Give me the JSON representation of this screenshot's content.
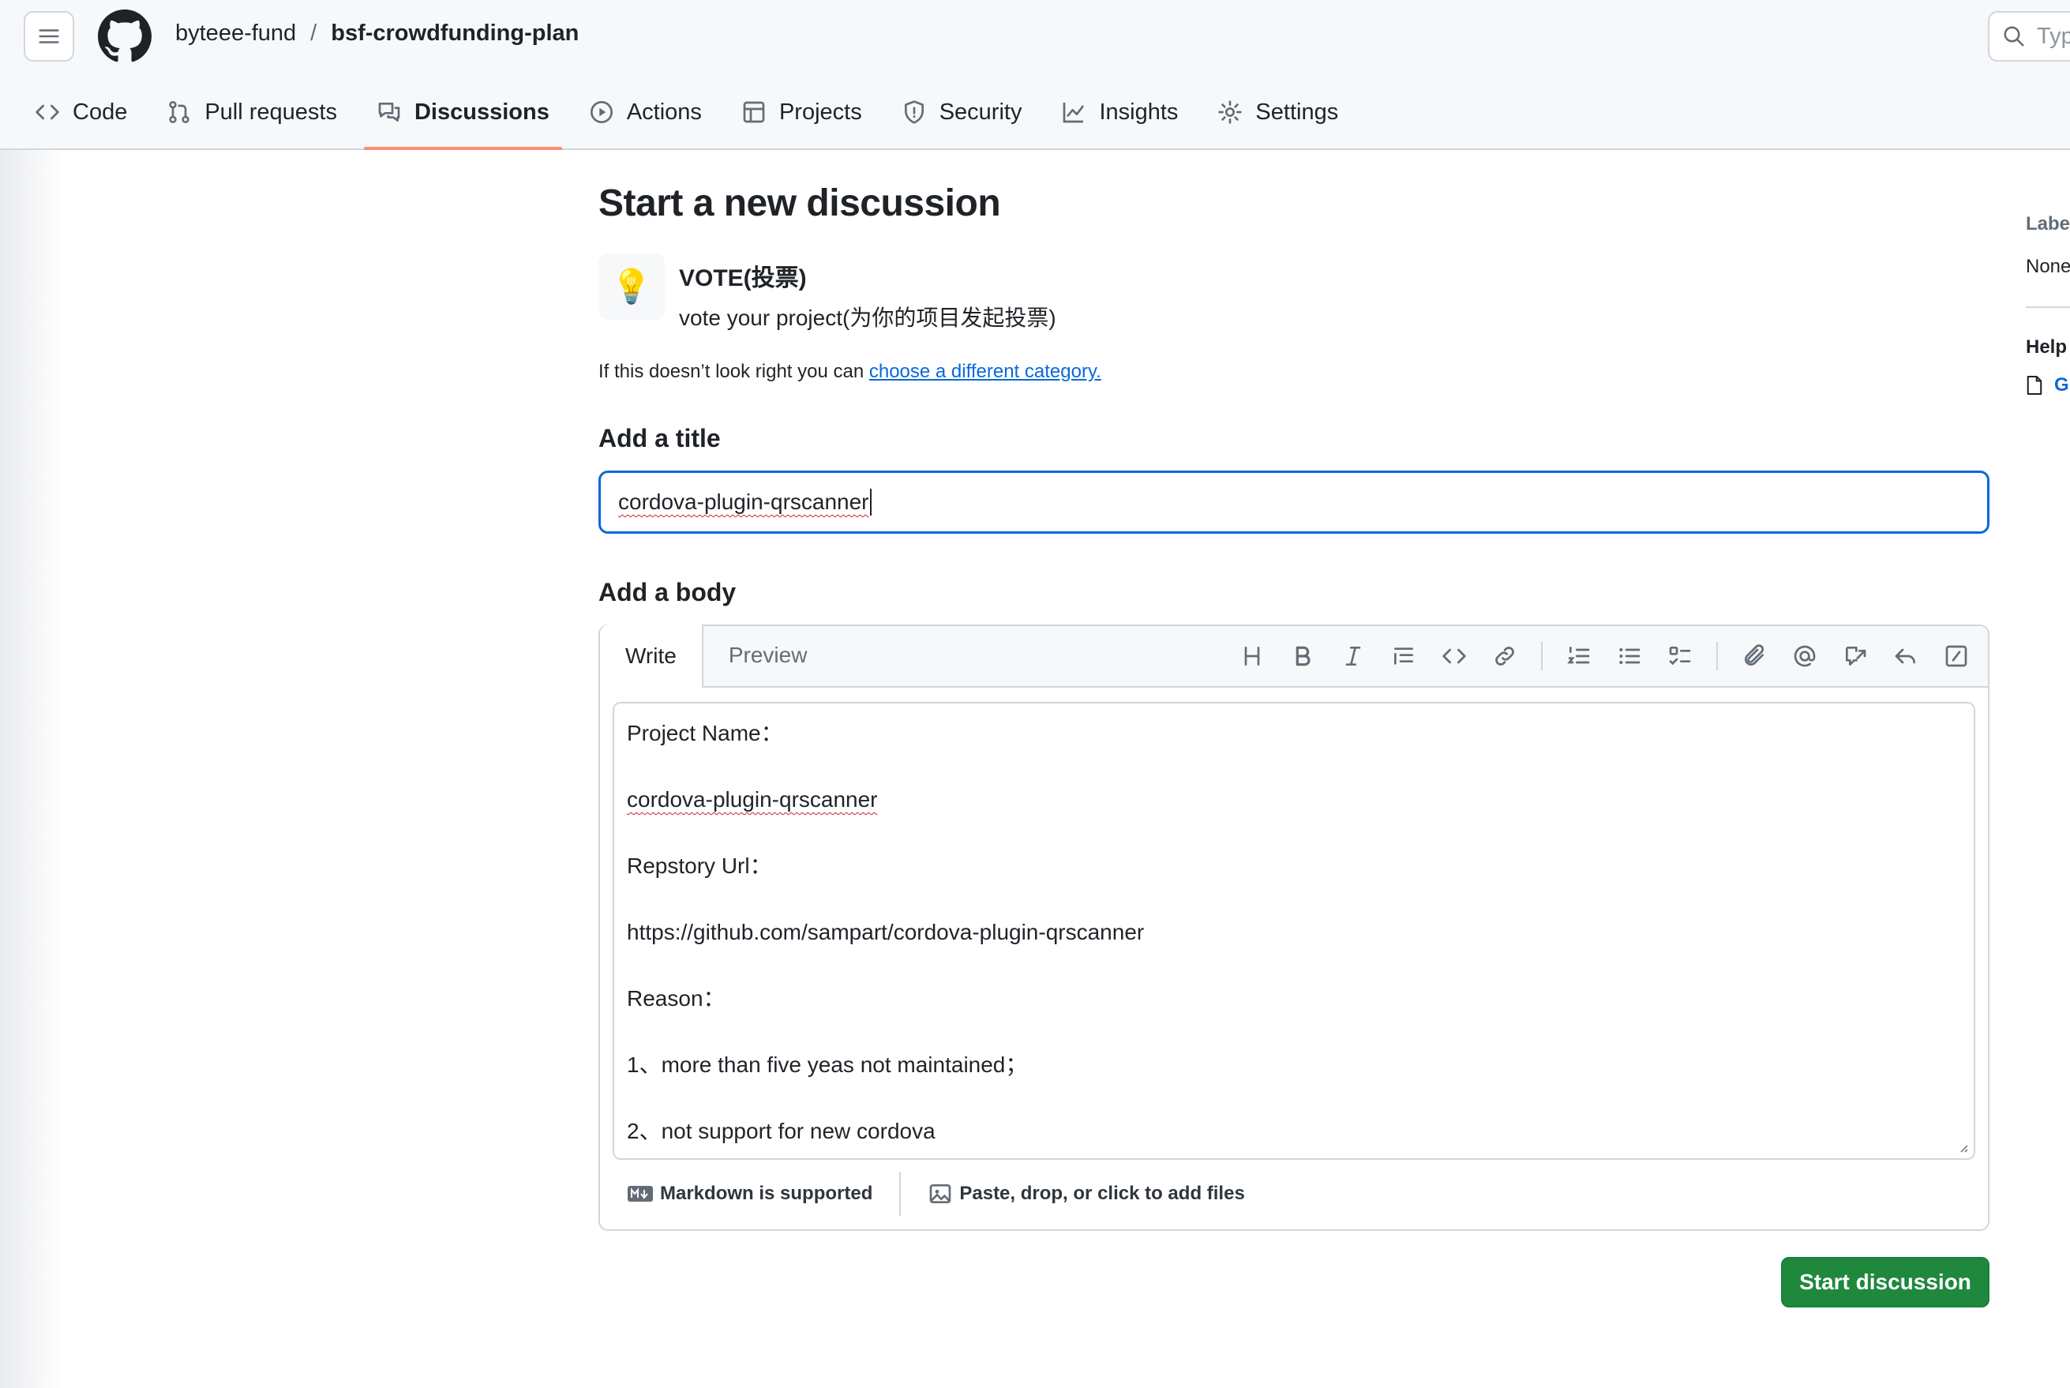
{
  "header": {
    "owner": "byteee-fund",
    "separator": "/",
    "repo": "bsf-crowdfunding-plan",
    "search_placeholder": "Typ"
  },
  "nav_tabs": [
    {
      "label": "Code",
      "icon": "code-icon"
    },
    {
      "label": "Pull requests",
      "icon": "pull-request-icon"
    },
    {
      "label": "Discussions",
      "icon": "discussion-icon",
      "active": true
    },
    {
      "label": "Actions",
      "icon": "play-icon"
    },
    {
      "label": "Projects",
      "icon": "table-icon"
    },
    {
      "label": "Security",
      "icon": "shield-icon"
    },
    {
      "label": "Insights",
      "icon": "graph-icon"
    },
    {
      "label": "Settings",
      "icon": "gear-icon"
    }
  ],
  "main": {
    "page_title": "Start a new discussion",
    "category": {
      "icon": "💡",
      "name": "VOTE(投票)",
      "description": "vote your project(为你的项目发起投票)"
    },
    "hint_text": "If this doesn’t look right you can ",
    "hint_link": "choose a different category.",
    "title_label": "Add a title",
    "title_value": "cordova-plugin-qrscanner",
    "body_label": "Add a body",
    "editor_tabs": {
      "write": "Write",
      "preview": "Preview"
    },
    "body_lines": [
      "Project Name：",
      "cordova-plugin-qrscanner",
      "Repstory Url：",
      "https://github.com/sampart/cordova-plugin-qrscanner",
      "Reason：",
      "1、more than five yeas not maintained；",
      "2、not support for new cordova"
    ],
    "footer_markdown": "Markdown is supported",
    "footer_files": "Paste, drop, or click to add files",
    "submit_label": "Start discussion"
  },
  "sidebar": {
    "labels_heading": "Labels",
    "labels_value": "None",
    "help_heading": "Help",
    "help_link": "G"
  },
  "colors": {
    "accent_blue": "#0969da",
    "tab_underline": "#fd8c73",
    "submit_green": "#1f883d"
  }
}
